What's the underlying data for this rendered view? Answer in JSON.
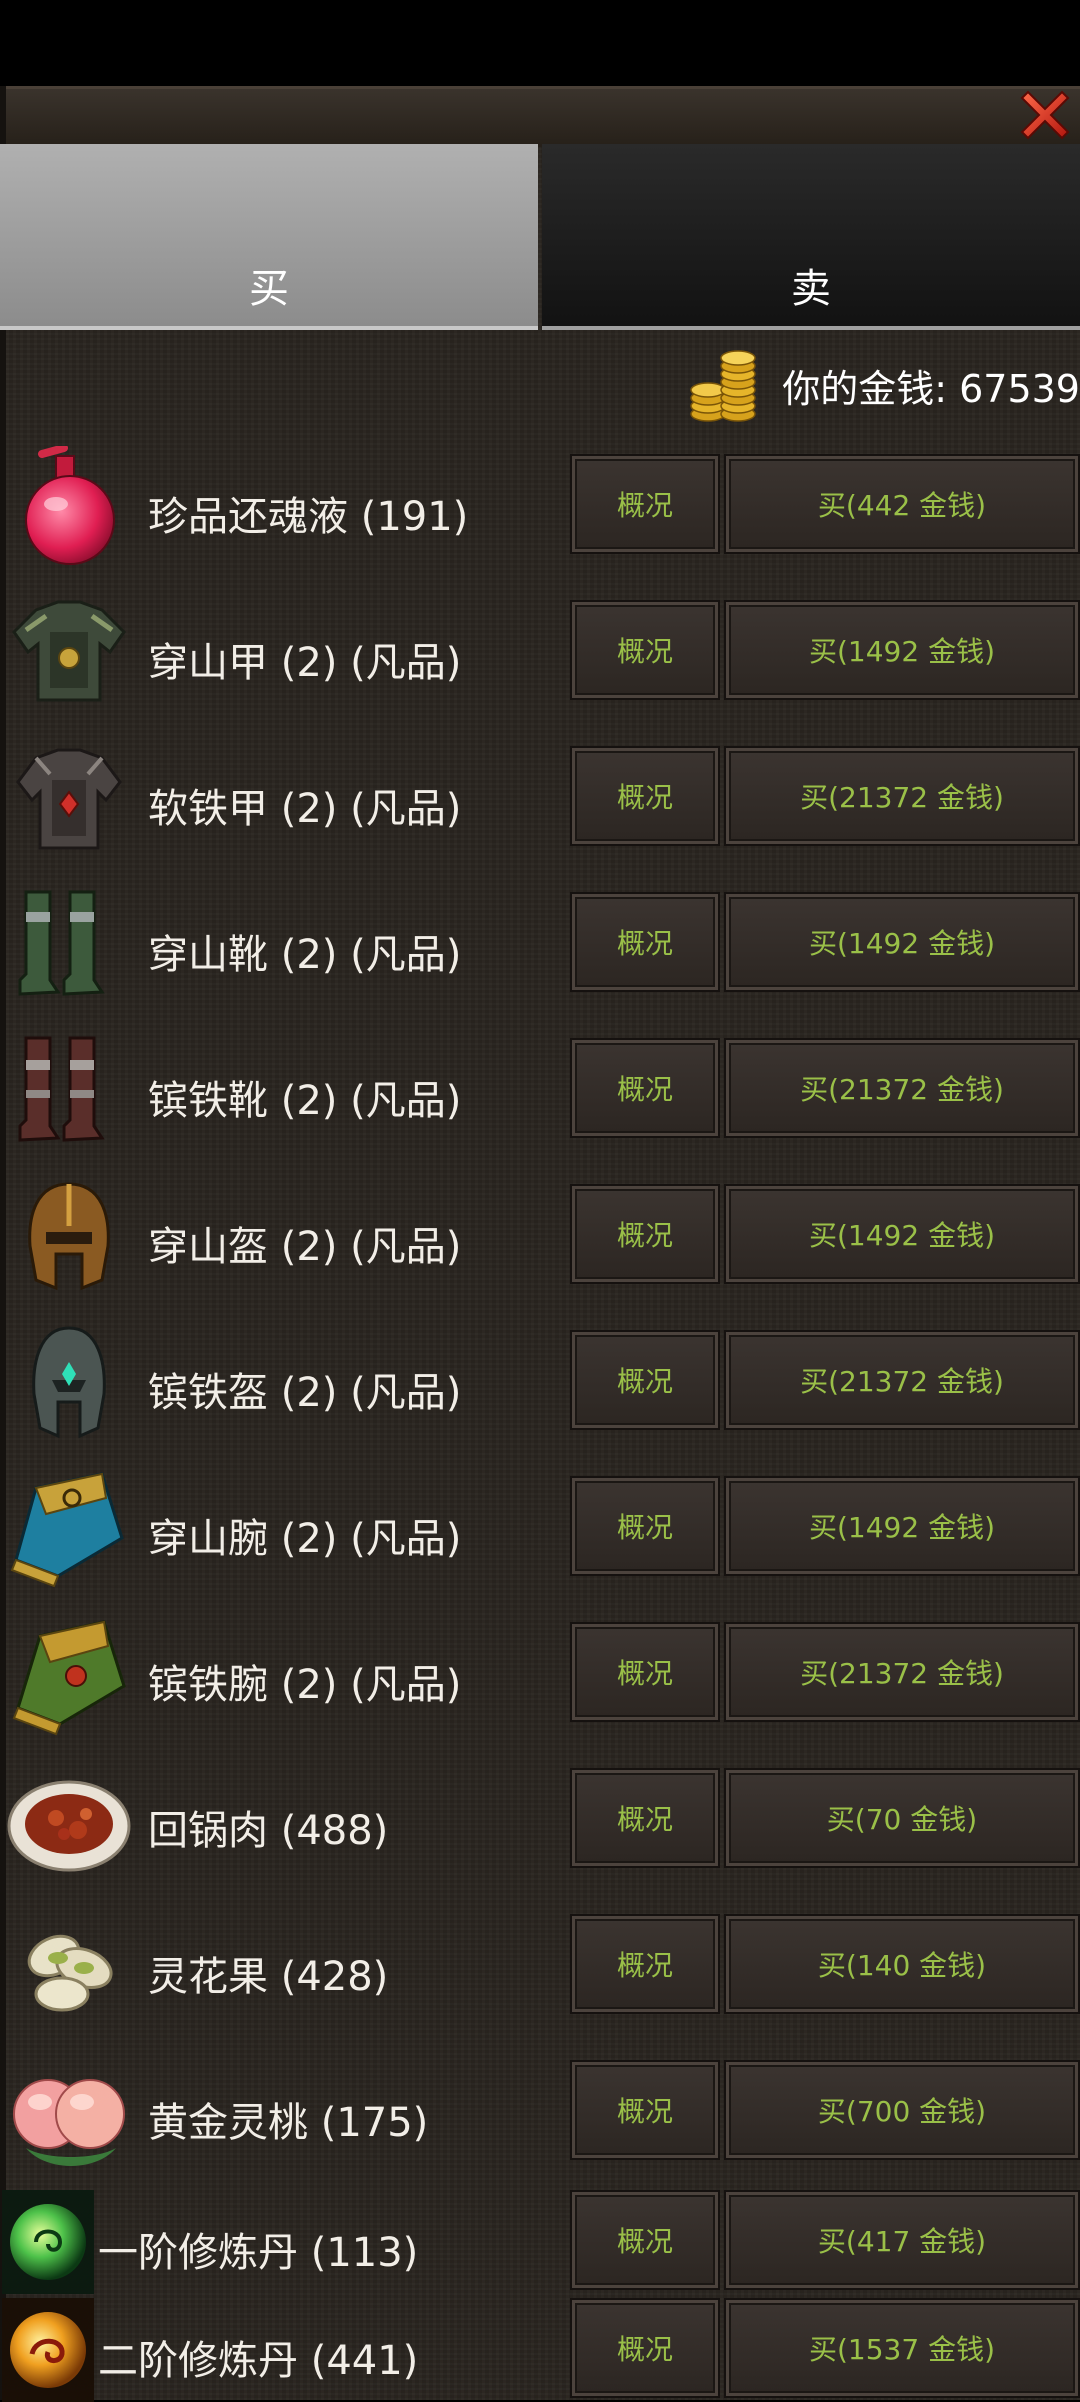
{
  "tabs": {
    "buy": "买",
    "sell": "卖"
  },
  "money": {
    "label": "你的金钱: 67539"
  },
  "info_label": "概况",
  "items": [
    {
      "name": "珍品还魂液 (191)",
      "price_label": "买(442 金钱)",
      "icon": "red-potion-icon"
    },
    {
      "name": "穿山甲 (2) (凡品)",
      "price_label": "买(1492 金钱)",
      "icon": "armor-icon"
    },
    {
      "name": "软铁甲 (2) (凡品)",
      "price_label": "买(21372 金钱)",
      "icon": "iron-armor-icon"
    },
    {
      "name": "穿山靴 (2) (凡品)",
      "price_label": "买(1492 金钱)",
      "icon": "boots-icon"
    },
    {
      "name": "镔铁靴 (2) (凡品)",
      "price_label": "买(21372 金钱)",
      "icon": "iron-boots-icon"
    },
    {
      "name": "穿山盔 (2) (凡品)",
      "price_label": "买(1492 金钱)",
      "icon": "helmet-icon"
    },
    {
      "name": "镔铁盔 (2) (凡品)",
      "price_label": "买(21372 金钱)",
      "icon": "iron-helmet-icon"
    },
    {
      "name": "穿山腕 (2) (凡品)",
      "price_label": "买(1492 金钱)",
      "icon": "bracer-icon"
    },
    {
      "name": "镔铁腕 (2) (凡品)",
      "price_label": "买(21372 金钱)",
      "icon": "iron-bracer-icon"
    },
    {
      "name": "回锅肉 (488)",
      "price_label": "买(70 金钱)",
      "icon": "meat-dish-icon"
    },
    {
      "name": "灵花果 (428)",
      "price_label": "买(140 金钱)",
      "icon": "nuts-icon"
    },
    {
      "name": "黄金灵桃 (175)",
      "price_label": "买(700 金钱)",
      "icon": "peach-icon"
    },
    {
      "name": "一阶修炼丹 (113)",
      "price_label": "买(417 金钱)",
      "icon": "green-pill-icon"
    },
    {
      "name": "二阶修炼丹 (441)",
      "price_label": "买(1537 金钱)",
      "icon": "gold-pill-icon"
    }
  ]
}
